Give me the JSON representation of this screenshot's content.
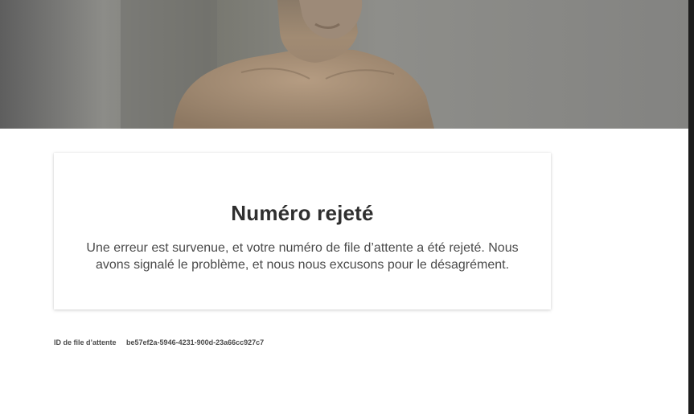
{
  "hero": {
    "image_description_icon": "portrait-photo"
  },
  "card": {
    "title": "Numéro rejeté",
    "message": "Une erreur est survenue, et votre numéro de file d’attente a été rejeté. Nous avons signalé le problème, et nous nous excusons pour le désagrément."
  },
  "queue": {
    "label": "ID de file d’attente",
    "id": "be57ef2a-5946-4231-900d-23a66cc927c7"
  },
  "colors": {
    "page_background": "#ffffff",
    "text_primary": "#2f2f2f",
    "text_secondary": "#4a4a4a",
    "scroll_edge": "#1c1c1c"
  }
}
